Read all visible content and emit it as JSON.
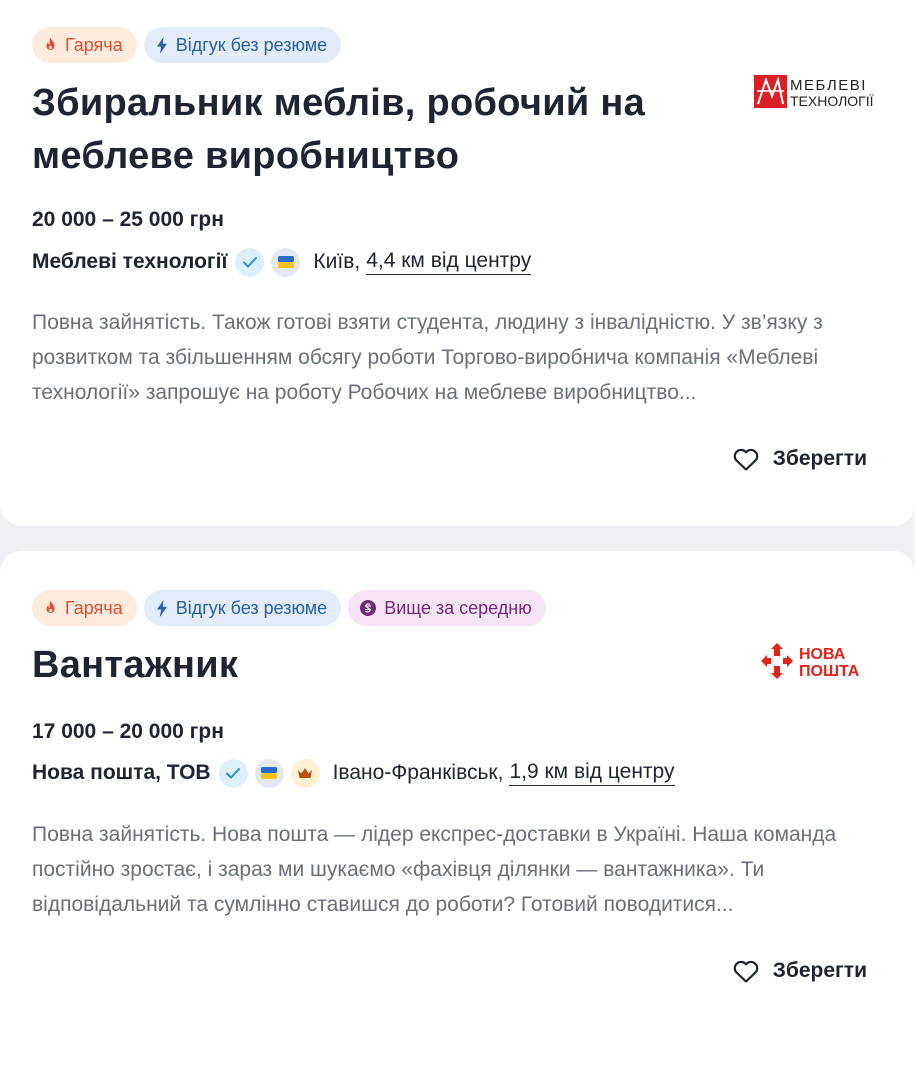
{
  "vacancies": [
    {
      "tags": [
        {
          "label": "Гаряча",
          "icon": "flame-icon"
        },
        {
          "label": "Відгук без резюме",
          "icon": "lightning-icon"
        }
      ],
      "title": "Збиральник меблів, робочий на меблеве виробництво",
      "salary": "20 000 – 25 000 грн",
      "company": "Меблеві технології",
      "city": "Київ,",
      "distance": "4,4 км від центру",
      "description": "Повна зайнятість. Також готові взяти студента, людину з інвалідністю. У зв’язку з розвитком та збільшенням обсягу роботи Торгово-виробнича компанія «Меблеві технології» запрошує на роботу Робочих на меблеве виробництво...",
      "save_label": "Зберегти",
      "logo": {
        "line1": "МЕБЛЕВІ",
        "line2": "ТЕХНОЛОГІЇ",
        "color": "#d81f26"
      }
    },
    {
      "tags": [
        {
          "label": "Гаряча",
          "icon": "flame-icon"
        },
        {
          "label": "Відгук без резюме",
          "icon": "lightning-icon"
        },
        {
          "label": "Вище за середню",
          "icon": "hryvnia-coin-icon"
        }
      ],
      "title": "Вантажник",
      "salary": "17 000 – 20 000 грн",
      "company": "Нова пошта, ТОВ",
      "city": "Івано-Франківськ,",
      "distance": "1,9 км від центру",
      "description": "Повна зайнятість. Нова пошта — лідер експрес-доставки в Україні. Наша команда постійно зростає, і зараз ми шукаємо «фахівця ділянки — вантажника». Ти відповідальний та сумлінно ставишся до роботи? Готовий поводитися...",
      "save_label": "Зберегти",
      "logo": {
        "line1": "НОВА",
        "line2": "ПОШТА",
        "color": "#e2231a"
      }
    }
  ],
  "colors": {
    "hot_bg": "#fdebdd",
    "hot_text": "#e54b2c",
    "fast_bg": "#e3ecf9",
    "fast_text": "#2a5ea8",
    "salary_bg": "#f5e4f6",
    "salary_text": "#6f2a7b"
  }
}
